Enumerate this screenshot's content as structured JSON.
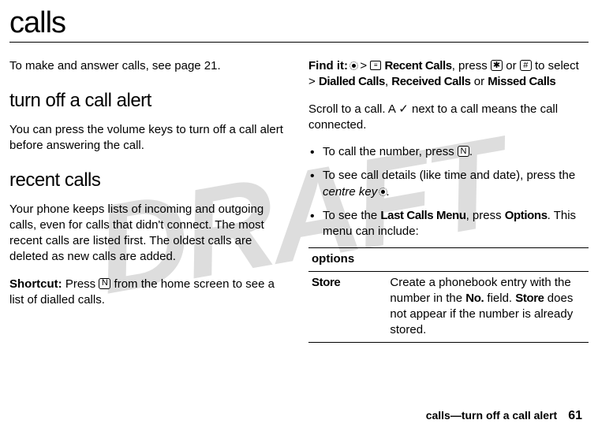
{
  "watermark": "DRAFT",
  "page_title": "calls",
  "left_column": {
    "intro": "To make and answer calls, see page 21.",
    "heading1": "turn off a call alert",
    "para1": "You can press the volume keys to turn off a call alert before answering the call.",
    "heading2": "recent calls",
    "para2": "Your phone keeps lists of incoming and outgoing calls, even for calls that didn't connect. The most recent calls are listed first. The oldest calls are deleted as new calls are added.",
    "shortcut_label": "Shortcut:",
    "shortcut_text_pre": " Press ",
    "shortcut_key": "N",
    "shortcut_text_post": " from the home screen to see a list of dialled calls."
  },
  "right_column": {
    "findit_label": "Find it:",
    "findit_gt": ">",
    "findit_recent": "Recent Calls",
    "findit_press": ", press ",
    "findit_star": "✱",
    "findit_or": " or ",
    "findit_hash": "#",
    "findit_toselect": " to select > ",
    "findit_dialled": "Dialled Calls",
    "findit_comma": ", ",
    "findit_received": "Received Calls",
    "findit_or2": " or ",
    "findit_missed": "Missed Calls",
    "scroll_pre": "Scroll to a call. A ",
    "scroll_check": "✓",
    "scroll_post": " next to a call means the call connected.",
    "bullets": {
      "b1_pre": "To call the number, press ",
      "b1_key": "N",
      "b1_post": ".",
      "b2_pre": "To see call details (like time and date), press the ",
      "b2_italic": "centre key",
      "b2_post": ".",
      "b3_pre": "To see the ",
      "b3_bold1": "Last Calls Menu",
      "b3_mid": ", press ",
      "b3_bold2": "Options",
      "b3_post": ". This menu can include:"
    },
    "table": {
      "header": "options",
      "row1_label": "Store",
      "row1_text_pre": "Create a phonebook entry with the number in the ",
      "row1_no": "No.",
      "row1_text_mid": " field. ",
      "row1_store": "Store",
      "row1_text_post": " does not appear if the number is already stored."
    }
  },
  "footer": {
    "text": "calls—turn off a call alert",
    "page_number": "61"
  }
}
